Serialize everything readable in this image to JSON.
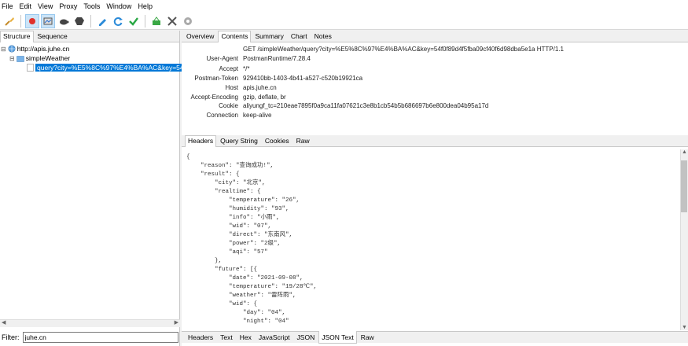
{
  "menu": [
    "File",
    "Edit",
    "View",
    "Proxy",
    "Tools",
    "Window",
    "Help"
  ],
  "toolbar": {
    "icons": [
      "broom-icon",
      "record-icon",
      "throttle-icon",
      "turtle-icon",
      "stop-icon",
      "pen-icon",
      "refresh-icon",
      "check-icon",
      "basket-icon",
      "tools-icon",
      "gear-icon"
    ],
    "accent": "#0078d7"
  },
  "left": {
    "tabs": [
      "Structure",
      "Sequence"
    ],
    "active_tab": "Structure",
    "tree": {
      "host": "http://apis.juhe.cn",
      "folder": "simpleWeather",
      "request": "query?city=%E5%8C%97%E4%BA%AC&key=54"
    },
    "filter_label": "Filter:",
    "filter_value": "juhe.cn"
  },
  "right": {
    "tabs": [
      "Overview",
      "Contents",
      "Summary",
      "Chart",
      "Notes"
    ],
    "active_tab": "Contents",
    "request_line": "GET /simpleWeather/query?city=%E5%8C%97%E4%BA%AC&key=54f0f89d4f5fba09cf40f6d98dba5e1a HTTP/1.1",
    "headers": [
      {
        "name": "User-Agent",
        "value": "PostmanRuntime/7.28.4"
      },
      {
        "name": "Accept",
        "value": "*/*"
      },
      {
        "name": "Postman-Token",
        "value": "929410bb-1403-4b41-a527-c520b19921ca"
      },
      {
        "name": "Host",
        "value": "apis.juhe.cn"
      },
      {
        "name": "Accept-Encoding",
        "value": "gzip, deflate, br"
      },
      {
        "name": "Cookie",
        "value": "aliyungf_tc=210eae7895f0a9ca11fa07621c3e8b1cb54b5b686697b6e800dea04b95a17d"
      },
      {
        "name": "Connection",
        "value": "keep-alive"
      }
    ],
    "sub_tabs": [
      "Headers",
      "Query String",
      "Cookies",
      "Raw"
    ],
    "active_sub_tab": "Headers",
    "json_lines": [
      "{",
      "    \"reason\": \"查询成功!\",",
      "    \"result\": {",
      "        \"city\": \"北京\",",
      "        \"realtime\": {",
      "            \"temperature\": \"26\",",
      "            \"humidity\": \"93\",",
      "            \"info\": \"小雨\",",
      "            \"wid\": \"07\",",
      "            \"direct\": \"东南风\",",
      "            \"power\": \"2级\",",
      "            \"aqi\": \"57\"",
      "        },",
      "        \"future\": [{",
      "            \"date\": \"2021-09-08\",",
      "            \"temperature\": \"19/28℃\",",
      "            \"weather\": \"雷阵雨\",",
      "            \"wid\": {",
      "                \"day\": \"04\",",
      "                \"night\": \"04\""
    ],
    "bottom_tabs": [
      "Headers",
      "Text",
      "Hex",
      "JavaScript",
      "JSON",
      "JSON Text",
      "Raw"
    ],
    "active_bottom_tab": "JSON Text"
  }
}
